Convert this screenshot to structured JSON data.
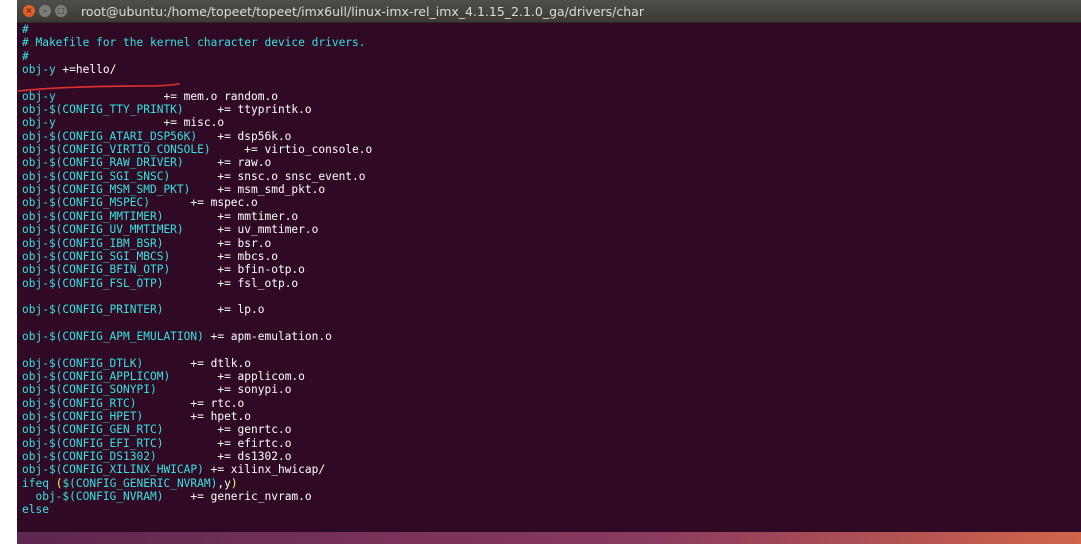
{
  "window": {
    "title": "root@ubuntu:/home/topeet/topeet/imx6ull/linux-imx-rel_imx_4.1.15_2.1.0_ga/drivers/char",
    "buttons": {
      "close": "×",
      "minimize": "–",
      "maximize": "□"
    }
  },
  "colors": {
    "background": "#300a24",
    "comment": "#34e2e2",
    "text": "#ffffff",
    "paren": "#ffff55",
    "annotation": "#e03030"
  },
  "lines": [
    [
      {
        "t": "#",
        "c": "c"
      }
    ],
    [
      {
        "t": "# Makefile for the kernel character device drivers.",
        "c": "c"
      }
    ],
    [
      {
        "t": "#",
        "c": "c"
      }
    ],
    [
      {
        "t": "obj-y",
        "c": "c"
      },
      {
        "t": " +=hello/",
        "c": "w"
      }
    ],
    [
      {
        "t": "",
        "c": "w"
      }
    ],
    [
      {
        "t": "obj-y",
        "c": "c"
      },
      {
        "t": "                += mem.o random.o",
        "c": "w"
      }
    ],
    [
      {
        "t": "obj-$(CONFIG_TTY_PRINTK)",
        "c": "c"
      },
      {
        "t": "     += ttyprintk.o",
        "c": "w"
      }
    ],
    [
      {
        "t": "obj-y",
        "c": "c"
      },
      {
        "t": "                += misc.o",
        "c": "w"
      }
    ],
    [
      {
        "t": "obj-$(CONFIG_ATARI_DSP56K)",
        "c": "c"
      },
      {
        "t": "   += dsp56k.o",
        "c": "w"
      }
    ],
    [
      {
        "t": "obj-$(CONFIG_VIRTIO_CONSOLE)",
        "c": "c"
      },
      {
        "t": "     += virtio_console.o",
        "c": "w"
      }
    ],
    [
      {
        "t": "obj-$(CONFIG_RAW_DRIVER)",
        "c": "c"
      },
      {
        "t": "     += raw.o",
        "c": "w"
      }
    ],
    [
      {
        "t": "obj-$(CONFIG_SGI_SNSC)",
        "c": "c"
      },
      {
        "t": "       += snsc.o snsc_event.o",
        "c": "w"
      }
    ],
    [
      {
        "t": "obj-$(CONFIG_MSM_SMD_PKT)",
        "c": "c"
      },
      {
        "t": "    += msm_smd_pkt.o",
        "c": "w"
      }
    ],
    [
      {
        "t": "obj-$(CONFIG_MSPEC)",
        "c": "c"
      },
      {
        "t": "      += mspec.o",
        "c": "w"
      }
    ],
    [
      {
        "t": "obj-$(CONFIG_MMTIMER)",
        "c": "c"
      },
      {
        "t": "        += mmtimer.o",
        "c": "w"
      }
    ],
    [
      {
        "t": "obj-$(CONFIG_UV_MMTIMER)",
        "c": "c"
      },
      {
        "t": "     += uv_mmtimer.o",
        "c": "w"
      }
    ],
    [
      {
        "t": "obj-$(CONFIG_IBM_BSR)",
        "c": "c"
      },
      {
        "t": "        += bsr.o",
        "c": "w"
      }
    ],
    [
      {
        "t": "obj-$(CONFIG_SGI_MBCS)",
        "c": "c"
      },
      {
        "t": "       += mbcs.o",
        "c": "w"
      }
    ],
    [
      {
        "t": "obj-$(CONFIG_BFIN_OTP)",
        "c": "c"
      },
      {
        "t": "       += bfin-otp.o",
        "c": "w"
      }
    ],
    [
      {
        "t": "obj-$(CONFIG_FSL_OTP)",
        "c": "c"
      },
      {
        "t": "        += fsl_otp.o",
        "c": "w"
      }
    ],
    [
      {
        "t": "",
        "c": "w"
      }
    ],
    [
      {
        "t": "obj-$(CONFIG_PRINTER)",
        "c": "c"
      },
      {
        "t": "        += lp.o",
        "c": "w"
      }
    ],
    [
      {
        "t": "",
        "c": "w"
      }
    ],
    [
      {
        "t": "obj-$(CONFIG_APM_EMULATION)",
        "c": "c"
      },
      {
        "t": " += apm-emulation.o",
        "c": "w"
      }
    ],
    [
      {
        "t": "",
        "c": "w"
      }
    ],
    [
      {
        "t": "obj-$(CONFIG_DTLK)",
        "c": "c"
      },
      {
        "t": "       += dtlk.o",
        "c": "w"
      }
    ],
    [
      {
        "t": "obj-$(CONFIG_APPLICOM)",
        "c": "c"
      },
      {
        "t": "       += applicom.o",
        "c": "w"
      }
    ],
    [
      {
        "t": "obj-$(CONFIG_SONYPI)",
        "c": "c"
      },
      {
        "t": "         += sonypi.o",
        "c": "w"
      }
    ],
    [
      {
        "t": "obj-$(CONFIG_RTC)",
        "c": "c"
      },
      {
        "t": "        += rtc.o",
        "c": "w"
      }
    ],
    [
      {
        "t": "obj-$(CONFIG_HPET)",
        "c": "c"
      },
      {
        "t": "       += hpet.o",
        "c": "w"
      }
    ],
    [
      {
        "t": "obj-$(CONFIG_GEN_RTC)",
        "c": "c"
      },
      {
        "t": "        += genrtc.o",
        "c": "w"
      }
    ],
    [
      {
        "t": "obj-$(CONFIG_EFI_RTC)",
        "c": "c"
      },
      {
        "t": "        += efirtc.o",
        "c": "w"
      }
    ],
    [
      {
        "t": "obj-$(CONFIG_DS1302)",
        "c": "c"
      },
      {
        "t": "         += ds1302.o",
        "c": "w"
      }
    ],
    [
      {
        "t": "obj-$(CONFIG_XILINX_HWICAP)",
        "c": "c"
      },
      {
        "t": " += xilinx_hwicap/",
        "c": "w"
      }
    ],
    [
      {
        "t": "ifeq ",
        "c": "c"
      },
      {
        "t": "(",
        "c": "k"
      },
      {
        "t": "$(CONFIG_GENERIC_NVRAM)",
        "c": "c"
      },
      {
        "t": ",y",
        "c": "w"
      },
      {
        "t": ")",
        "c": "k"
      }
    ],
    [
      {
        "t": "  obj-$(CONFIG_NVRAM)",
        "c": "c"
      },
      {
        "t": "    += generic_nvram.o",
        "c": "w"
      }
    ],
    [
      {
        "t": "else",
        "c": "c"
      }
    ]
  ]
}
